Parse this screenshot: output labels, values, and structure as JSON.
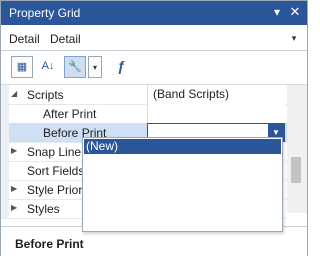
{
  "window": {
    "title": "Property Grid",
    "pin_glyph": "▾",
    "close_glyph": "✕"
  },
  "selector": {
    "object_name": "Detail",
    "object_type": "Detail",
    "dropdown_glyph": "▾"
  },
  "toolbar": {
    "categorized_glyph": "▦",
    "alphabetical_glyph": "A↓",
    "properties_glyph": "🔧",
    "menu_glyph": "▾",
    "events_glyph": "ƒ"
  },
  "rows": [
    {
      "label": "Scripts",
      "value": "(Band Scripts)",
      "expander": "◢"
    },
    {
      "label": "After Print",
      "value": ""
    },
    {
      "label": "Before Print",
      "value": ""
    },
    {
      "label": "Snap Line P",
      "value": "",
      "expander": "▶"
    },
    {
      "label": "Sort Fields",
      "value": ""
    },
    {
      "label": "Style Priorit",
      "value": "",
      "expander": "▶"
    },
    {
      "label": "Styles",
      "value": "",
      "expander": "▶"
    }
  ],
  "editor": {
    "button_glyph": "▼"
  },
  "dropdown": {
    "items": [
      "(New)"
    ]
  },
  "description": {
    "title": "Before Print"
  },
  "colors": {
    "accent": "#2b579a",
    "selection": "#cfe0f4"
  }
}
